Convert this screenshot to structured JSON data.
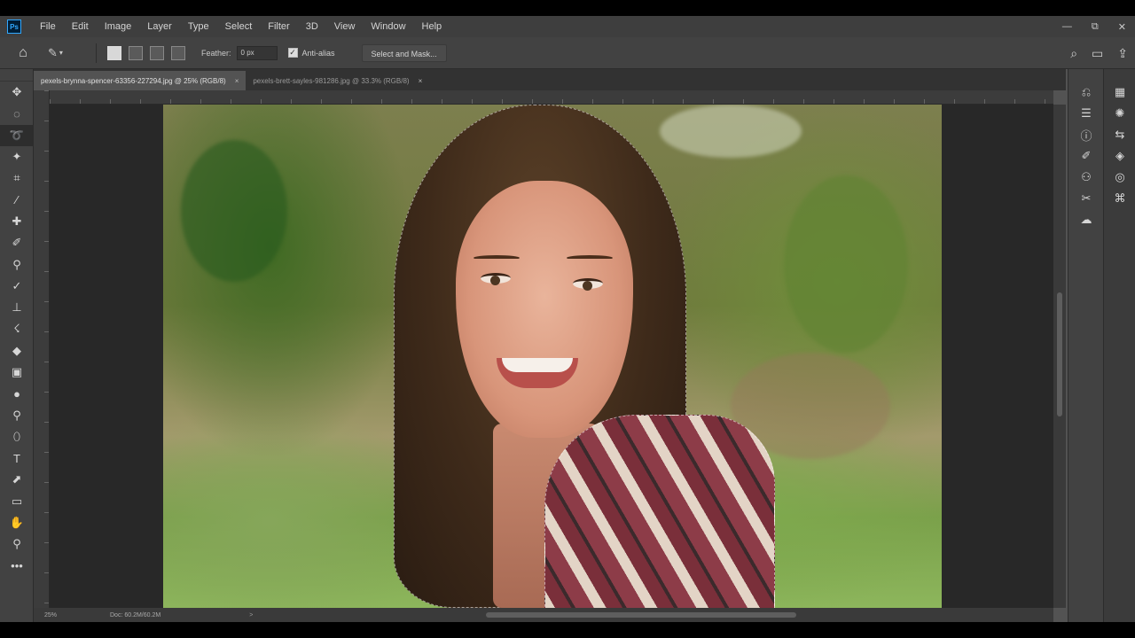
{
  "app": {
    "logo": "Ps"
  },
  "menu": [
    "File",
    "Edit",
    "Image",
    "Layer",
    "Type",
    "Select",
    "Filter",
    "3D",
    "View",
    "Window",
    "Help"
  ],
  "window_controls": {
    "minimize": "—",
    "restore": "⧉",
    "close": "✕"
  },
  "options_bar": {
    "feather_label": "Feather:",
    "feather_value": "0 px",
    "anti_alias_label": "Anti-alias",
    "anti_alias_checked": true,
    "select_and_mask": "Select and Mask..."
  },
  "tabs": [
    {
      "label": "pexels-brynna-spencer-63356-227294.jpg @ 25% (RGB/8)",
      "active": true,
      "close": "×"
    },
    {
      "label": "pexels-brett-sayles-981286.jpg @ 33.3% (RGB/8)",
      "active": false,
      "close": "×"
    }
  ],
  "status": {
    "zoom": "25%",
    "doc": "Doc: 60.2M/60.2M",
    "arrow": ">"
  },
  "tools": [
    "move-icon",
    "marquee-icon",
    "lasso-icon",
    "magic-wand-icon",
    "crop-icon",
    "eyedropper-icon",
    "healing-brush-icon",
    "brush-icon",
    "clone-stamp-icon",
    "history-brush-icon",
    "stamp-icon",
    "smudge-icon",
    "eraser-icon",
    "gradient-icon",
    "blur-icon",
    "dodge-icon",
    "pen-icon",
    "type-icon",
    "path-selection-icon",
    "rectangle-icon",
    "hand-icon",
    "zoom-icon",
    "more-icon"
  ],
  "active_tool_index": 2
}
